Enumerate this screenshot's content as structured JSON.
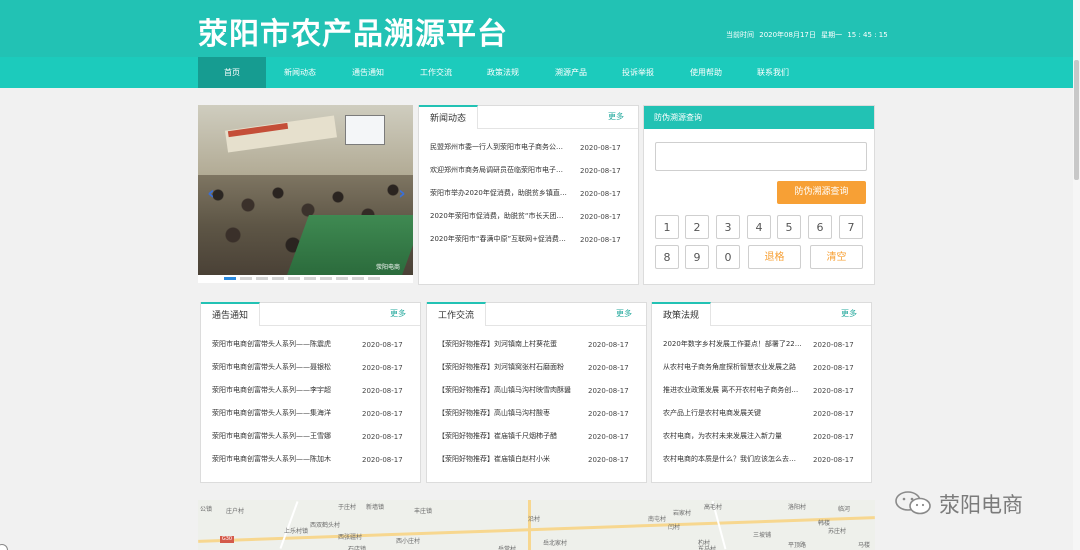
{
  "header": {
    "title": "荥阳市农产品溯源平台",
    "datetime_label": "当前时间",
    "date": "2020年08月17日",
    "weekday": "星期一",
    "time": "15 : 45 : 15"
  },
  "nav": {
    "items": [
      {
        "label": "首页",
        "active": true
      },
      {
        "label": "新闻动态"
      },
      {
        "label": "通告通知"
      },
      {
        "label": "工作交流"
      },
      {
        "label": "政策法规"
      },
      {
        "label": "溯源产品"
      },
      {
        "label": "投诉举报"
      },
      {
        "label": "使用帮助"
      },
      {
        "label": "联系我们"
      }
    ]
  },
  "banner": {
    "watermark": "荥阳电商",
    "slide_count": 10,
    "active_slide": 1
  },
  "more_label": "更多",
  "news": {
    "title": "新闻动态",
    "items": [
      {
        "title": "民盟郑州市委一行人到荥阳市电子商务公…",
        "date": "2020-08-17"
      },
      {
        "title": "欢迎郑州市商务局调研员莅临荥阳市电子…",
        "date": "2020-08-17"
      },
      {
        "title": "荥阳市举办2020年促消费，助脱贫乡镇直…",
        "date": "2020-08-17"
      },
      {
        "title": "2020年荥阳市促消费，助脱贫“市长天团…",
        "date": "2020-08-17"
      },
      {
        "title": "2020年荥阳市“春满中原”互联网+促消费…",
        "date": "2020-08-17"
      }
    ]
  },
  "query": {
    "title": "防伪溯源查询",
    "button": "防伪溯源查询",
    "keys_row1": [
      "1",
      "2",
      "3",
      "4",
      "5",
      "6",
      "7"
    ],
    "keys_row2": [
      "8",
      "9",
      "0"
    ],
    "backspace": "退格",
    "clear": "清空"
  },
  "notices": {
    "title": "通告通知",
    "items": [
      {
        "title": "荥阳市电商创富带头人系列——陈震虎",
        "date": "2020-08-17"
      },
      {
        "title": "荥阳市电商创富带头人系列——聂银松",
        "date": "2020-08-17"
      },
      {
        "title": "荥阳市电商创富带头人系列——李宇超",
        "date": "2020-08-17"
      },
      {
        "title": "荥阳市电商创富带头人系列——集海洋",
        "date": "2020-08-17"
      },
      {
        "title": "荥阳市电商创富带头人系列——王雪娜",
        "date": "2020-08-17"
      },
      {
        "title": "荥阳市电商创富带头人系列——陈加木",
        "date": "2020-08-17"
      }
    ]
  },
  "work": {
    "title": "工作交流",
    "items": [
      {
        "title": "【荥阳好物推荐】刘河镇南上村葵花蛋",
        "date": "2020-08-17"
      },
      {
        "title": "【荥阳好物推荐】刘河镇窝张村石磨面粉",
        "date": "2020-08-17"
      },
      {
        "title": "【荥阳好物推荐】高山镇马沟村映雪肉酥醤",
        "date": "2020-08-17"
      },
      {
        "title": "【荥阳好物推荐】高山镇马沟村酸枣",
        "date": "2020-08-17"
      },
      {
        "title": "【荥阳好物推荐】崔庙镇千尺烟柿子醋",
        "date": "2020-08-17"
      },
      {
        "title": "【荥阳好物推荐】崔庙镇白赵村小米",
        "date": "2020-08-17"
      }
    ]
  },
  "policy": {
    "title": "政策法规",
    "items": [
      {
        "title": "2020年数字乡村发展工作要点！部署了22…",
        "date": "2020-08-17"
      },
      {
        "title": "从农村电子商务角度探析智慧农业发展之路",
        "date": "2020-08-17"
      },
      {
        "title": "推进农业政策发展 离不开农村电子商务创…",
        "date": "2020-08-17"
      },
      {
        "title": "农产品上行是农村电商发展关键",
        "date": "2020-08-17"
      },
      {
        "title": "农村电商，为农村未来发展注入新力量",
        "date": "2020-08-17"
      },
      {
        "title": "农村电商的本质是什么？我们应该怎么去…",
        "date": "2020-08-17"
      }
    ]
  },
  "map": {
    "labels": [
      "公镇",
      "庄户村",
      "上乐村镇",
      "西双鹤头村",
      "于庄村",
      "新墙镇",
      "丰庄镇",
      "西张疆村",
      "西小庄村",
      "石店镇",
      "沿村",
      "岳堂村",
      "岳北家村",
      "岩家村",
      "闫村",
      "南屯村",
      "高毛村",
      "洛阳村",
      "三坡铺",
      "平顶路",
      "杓村",
      "临河",
      "韩楼",
      "马楼",
      "东马村",
      "苏庄村"
    ],
    "shield": "G30"
  },
  "footer_watermark": "荥阳电商"
}
